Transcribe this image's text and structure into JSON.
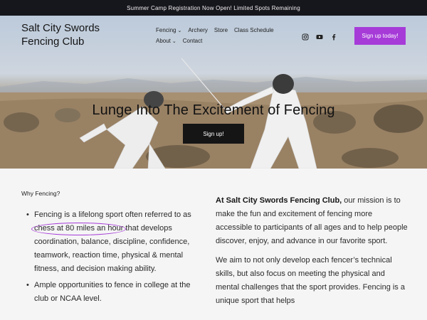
{
  "banner": {
    "text": "Summer Camp Registration Now Open! Limited Spots Remaining"
  },
  "header": {
    "logo_line1": "Salt City Swords",
    "logo_line2": "Fencing Club",
    "nav": {
      "fencing": "Fencing",
      "archery": "Archery",
      "store": "Store",
      "class_schedule": "Class Schedule",
      "about": "About",
      "contact": "Contact"
    },
    "socials": [
      "instagram-icon",
      "youtube-icon",
      "facebook-icon"
    ],
    "cta_label": "Sign up today!"
  },
  "hero": {
    "title": "Lunge Into The Excitement of Fencing",
    "button_label": "Sign up!"
  },
  "why": {
    "heading": "Why Fencing?",
    "bullet1_pre": "Fencing is a lifelong sport often referred to as ",
    "bullet1_highlight": "chess at 80 miles an hour",
    "bullet1_post": " that develops coordination, balance, discipline, confidence, teamwork, reaction time, physical & mental fitness, and decision making ability.",
    "bullet2": "Ample opportunities to fence in college at the club or NCAA level."
  },
  "mission": {
    "lead_bold": "At Salt City Swords Fencing Club,",
    "lead_rest": " our mission is to make the fun and excitement of fencing more accessible to participants of all ages and to help people discover, enjoy, and advance in our favorite sport.",
    "para2": "We aim to not only develop each fencer’s technical skills, but also focus on meeting the physical and mental challenges that the sport provides. Fencing is a unique sport that helps"
  },
  "colors": {
    "accent": "#a63bd8",
    "banner_bg": "#16161d",
    "hero_button_bg": "#151515"
  }
}
